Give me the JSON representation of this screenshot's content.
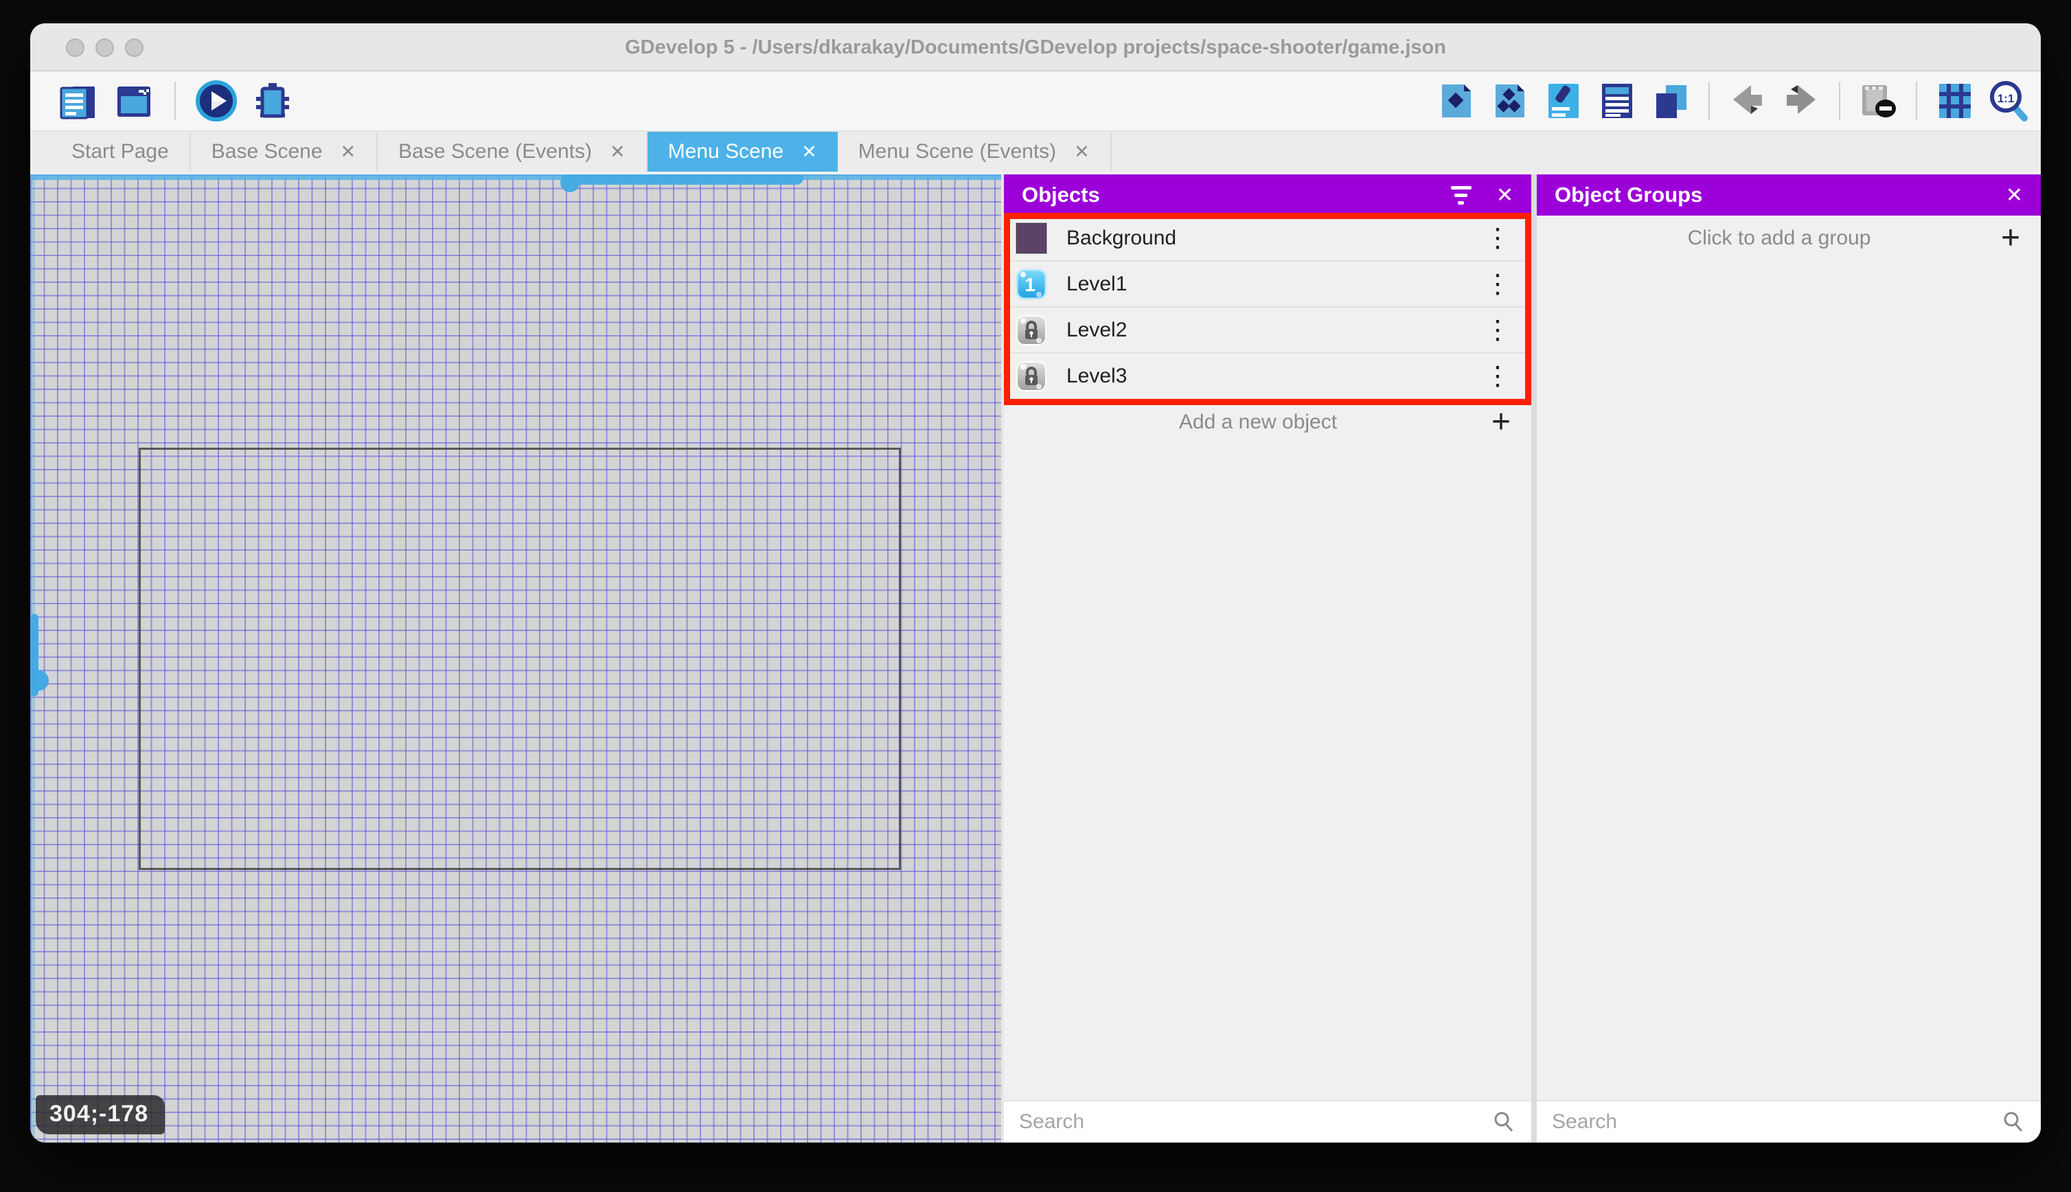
{
  "window": {
    "title": "GDevelop 5 - /Users/dkarakay/Documents/GDevelop projects/space-shooter/game.json",
    "traffic_lights": [
      "close",
      "minimize",
      "zoom"
    ]
  },
  "toolbar": {
    "left_icons": [
      "project-manager",
      "preview-window",
      "play-preview",
      "debug"
    ],
    "right_icons": [
      "objects-editor",
      "object-groups-editor",
      "properties",
      "instances-list",
      "layers",
      "undo",
      "redo",
      "render-mask-disabled",
      "grid",
      "zoom-1-1"
    ]
  },
  "tabs": [
    {
      "label": "Start Page",
      "closable": false,
      "active": false
    },
    {
      "label": "Base Scene",
      "closable": true,
      "active": false,
      "close_glyph": "✕"
    },
    {
      "label": "Base Scene (Events)",
      "closable": true,
      "active": false,
      "close_glyph": "✕"
    },
    {
      "label": "Menu Scene",
      "closable": true,
      "active": true,
      "close_glyph": "✕"
    },
    {
      "label": "Menu Scene (Events)",
      "closable": true,
      "active": false,
      "close_glyph": "✕"
    }
  ],
  "canvas": {
    "coordinates_badge": "304;-178"
  },
  "objects_panel": {
    "title": "Objects",
    "header_icons": [
      "filter",
      "close"
    ],
    "close_glyph": "✕",
    "items": [
      {
        "name": "Background",
        "icon": "color-swatch-purple",
        "menu_glyph": "⋮"
      },
      {
        "name": "Level1",
        "icon": "cyan-button-1",
        "menu_glyph": "⋮"
      },
      {
        "name": "Level2",
        "icon": "locked-gray-button",
        "menu_glyph": "⋮"
      },
      {
        "name": "Level3",
        "icon": "locked-gray-button",
        "menu_glyph": "⋮"
      }
    ],
    "add_label": "Add a new object",
    "add_glyph": "+",
    "search_placeholder": "Search"
  },
  "object_groups_panel": {
    "title": "Object Groups",
    "header_icons": [
      "close"
    ],
    "close_glyph": "✕",
    "empty_label": "Click to add a group",
    "add_glyph": "+",
    "search_placeholder": "Search"
  },
  "colors": {
    "panel_header_purple": "#9c00d8",
    "active_tab_blue": "#4db2e8",
    "highlight_red": "#ff1f05",
    "canvas_bg": "#d4d4d4",
    "grid_line": "#5c58da",
    "icon_blue_dark": "#2b3990",
    "icon_blue_light": "#49a8dc"
  }
}
